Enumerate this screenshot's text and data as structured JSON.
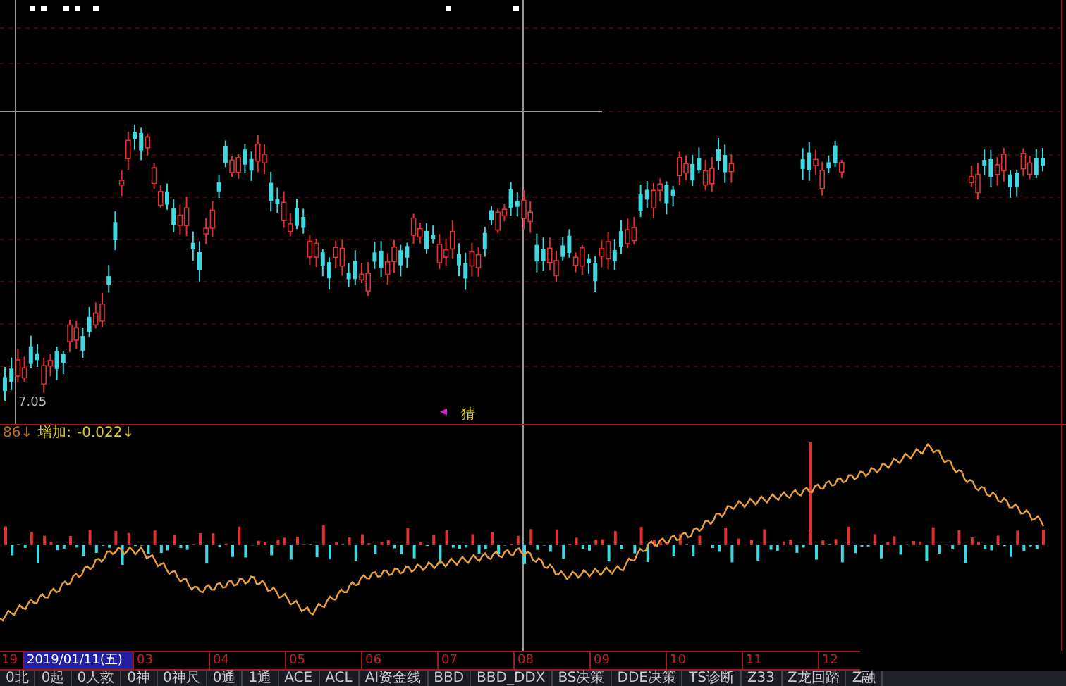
{
  "price_label": "7.05",
  "signal_marks": [
    {
      "text": "◂",
      "color": "#d020d0"
    },
    {
      "text": "猜",
      "color": "#e0d020"
    }
  ],
  "indicator_legend": [
    {
      "text": "86↓",
      "color": "#c07020"
    },
    {
      "text": "增加:",
      "color": "#e0d020"
    },
    {
      "text": "-0.022↓",
      "color": "#e0d020"
    }
  ],
  "date_axis": [
    {
      "text": "19",
      "selected": false
    },
    {
      "text": "2019/01/11(五)",
      "selected": true
    },
    {
      "text": "03",
      "selected": false
    },
    {
      "text": "04",
      "selected": false
    },
    {
      "text": "05",
      "selected": false
    },
    {
      "text": "06",
      "selected": false
    },
    {
      "text": "07",
      "selected": false
    },
    {
      "text": "08",
      "selected": false
    },
    {
      "text": "09",
      "selected": false
    },
    {
      "text": "10",
      "selected": false
    },
    {
      "text": "11",
      "selected": false
    },
    {
      "text": "12",
      "selected": false
    }
  ],
  "tabs": [
    "0北",
    "0起",
    "0人救",
    "0神",
    "0神尺",
    "0通",
    "1通",
    "ACE",
    "ACL",
    "AI资金线",
    "BBD",
    "BBD_DDX",
    "BS决策",
    "DDE决策",
    "TS诊断",
    "Z33",
    "Z龙回踏",
    "Z融"
  ]
}
